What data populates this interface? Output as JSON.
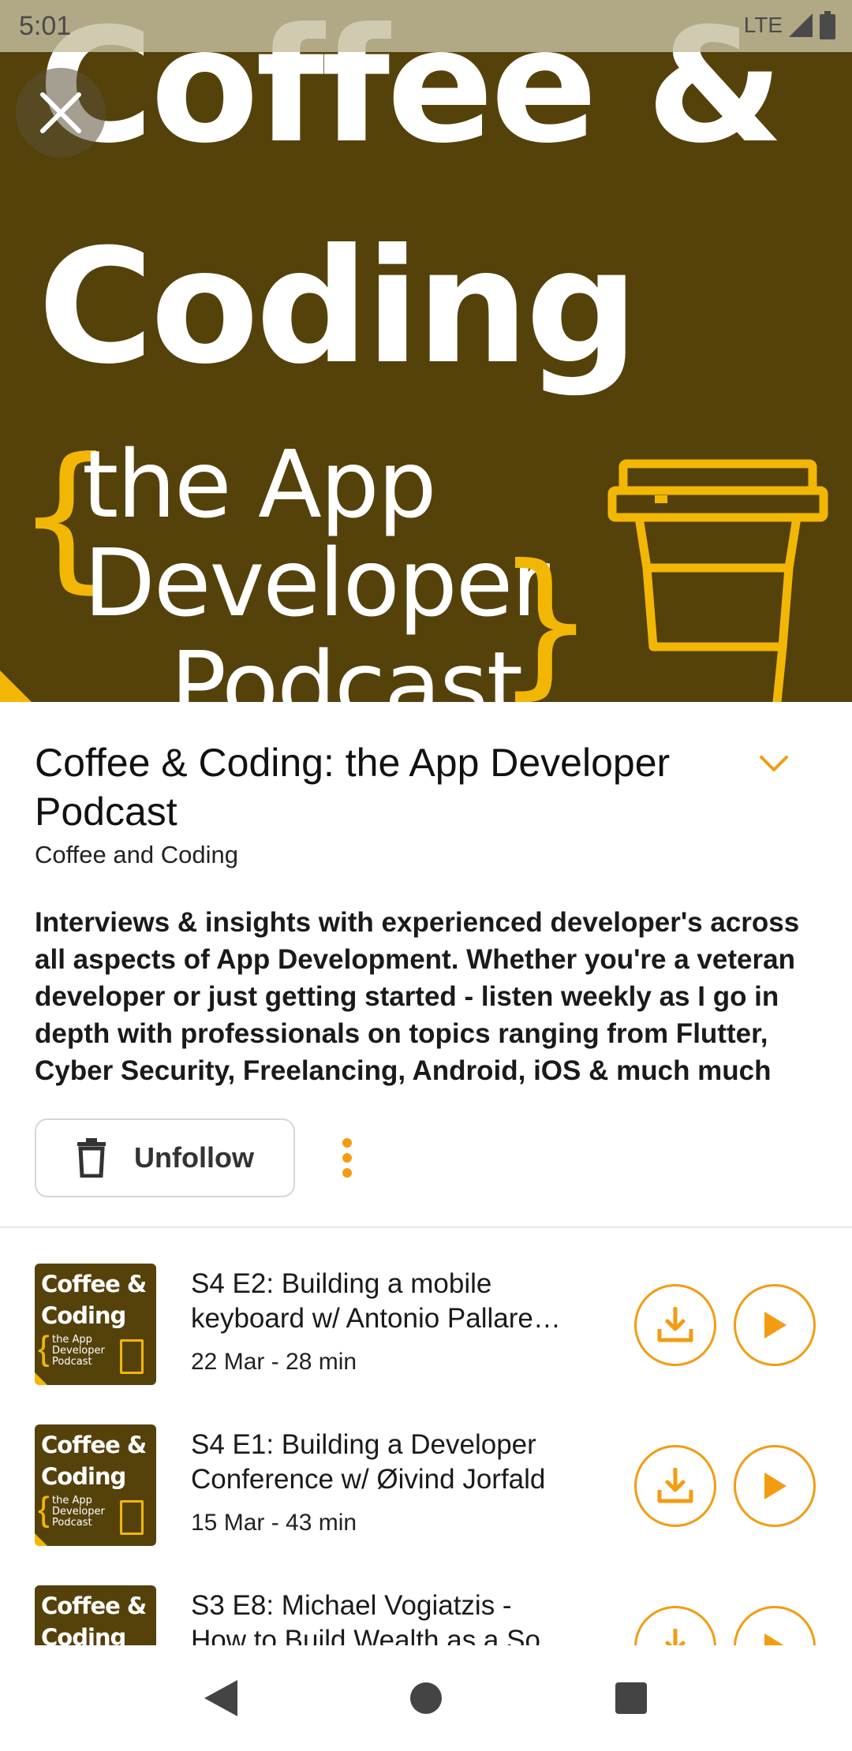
{
  "status_bar": {
    "time": "5:01",
    "network": "LTE"
  },
  "cover": {
    "line1": "Coffee &",
    "line2": "Coding",
    "line3": "the App",
    "line4": "Developer",
    "line5": "Podcast"
  },
  "podcast": {
    "title": "Coffee & Coding: the App Developer Podcast",
    "author": "Coffee and Coding",
    "description": "Interviews & insights with experienced developer's across all aspects of App Development. Whether you're a veteran developer or just getting started - listen weekly as I go in depth with professionals on topics ranging from Flutter, Cyber Security, Freelancing, Android, iOS & much much"
  },
  "actions": {
    "unfollow_label": "Unfollow"
  },
  "thumbnail": {
    "line1": "Coffee &",
    "line2": "Coding",
    "line3": "the App Developer Podcast"
  },
  "episodes": [
    {
      "title_line1": "S4 E2: Building a mobile",
      "title_line2": "keyboard w/ Antonio Pallare…",
      "meta": "22 Mar - 28 min"
    },
    {
      "title_line1": "S4 E1: Building a Developer",
      "title_line2": "Conference w/ Øivind Jorfald",
      "meta": "15 Mar - 43 min"
    },
    {
      "title_line1": "S3 E8: Michael Vogiatzis -",
      "title_line2": "How to Build Wealth as a So…",
      "meta": ""
    }
  ],
  "colors": {
    "accent": "#f39c12",
    "cover_bg": "#55420b",
    "cover_yellow": "#f2b705"
  },
  "icons": {
    "close": "close-icon",
    "expand": "chevron-down-icon",
    "trash": "trash-icon",
    "more": "more-vertical-icon",
    "download": "download-icon",
    "play": "play-icon",
    "back": "back-icon",
    "home": "home-icon",
    "recents": "recents-icon"
  }
}
